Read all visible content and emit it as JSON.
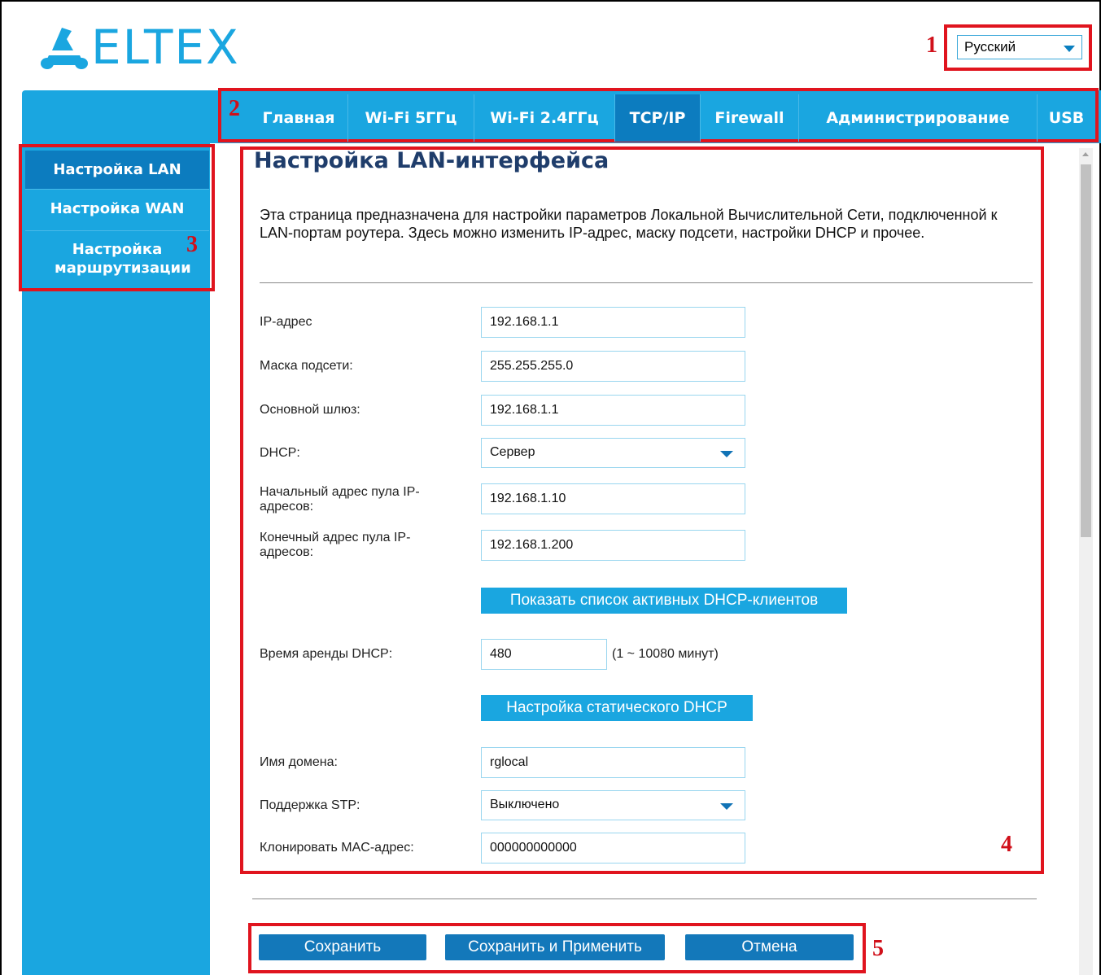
{
  "header": {
    "logo_text": "ELTEX",
    "language": "Русский"
  },
  "markers": [
    "1",
    "2",
    "3",
    "4",
    "5"
  ],
  "nav": {
    "tabs": [
      {
        "label": "Главная"
      },
      {
        "label": "Wi-Fi 5ГГц"
      },
      {
        "label": "Wi-Fi 2.4ГГц"
      },
      {
        "label": "TCP/IP",
        "active": true
      },
      {
        "label": "Firewall"
      },
      {
        "label": "Администрирование"
      },
      {
        "label": "USB"
      }
    ]
  },
  "sidebar": {
    "items": [
      {
        "label": "Настройка LAN",
        "active": true
      },
      {
        "label": "Настройка WAN"
      },
      {
        "label": "Настройка маршрутизации"
      }
    ]
  },
  "main": {
    "title": "Настройка LAN-интерфейса",
    "description": "Эта страница предназначена для настройки параметров Локальной Вычислительной Сети, подключенной к LAN-портам роутера. Здесь можно изменить IP-адрес, маску подсети, настройки DHCP и прочее.",
    "fields": {
      "ip_label": "IP-адрес",
      "ip_value": "192.168.1.1",
      "mask_label": "Маска подсети:",
      "mask_value": "255.255.255.0",
      "gateway_label": "Основной шлюз:",
      "gateway_value": "192.168.1.1",
      "dhcp_label": "DHCP:",
      "dhcp_value": "Сервер",
      "pool_start_label": "Начальный адрес пула IP-адресов:",
      "pool_start_value": "192.168.1.10",
      "pool_end_label": "Конечный адрес пула IP-адресов:",
      "pool_end_value": "192.168.1.200",
      "show_clients_button": "Показать список активных DHCP-клиентов",
      "lease_label": "Время аренды DHCP:",
      "lease_value": "480",
      "lease_hint": "(1 ~ 10080 минут)",
      "static_dhcp_button": "Настройка статического DHCP",
      "domain_label": "Имя домена:",
      "domain_value": "rglocal",
      "stp_label": "Поддержка STP:",
      "stp_value": "Выключено",
      "mac_label": "Клонировать MAC-адрес:",
      "mac_value": "000000000000"
    }
  },
  "footer": {
    "save": "Сохранить",
    "save_apply": "Сохранить и Применить",
    "cancel": "Отмена"
  }
}
